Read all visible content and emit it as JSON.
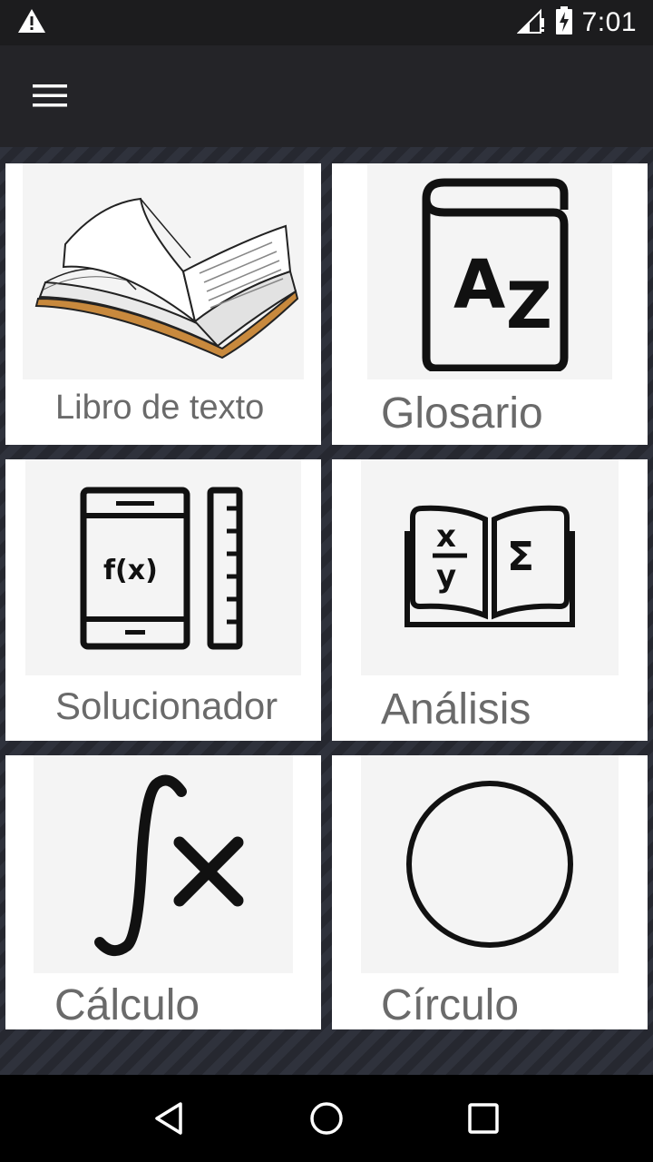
{
  "status_bar": {
    "time": "7:01",
    "icons": [
      "warning-icon",
      "signal-icon",
      "battery-charging-icon"
    ]
  },
  "app_bar": {
    "menu_icon": "hamburger-menu-icon"
  },
  "cards": [
    {
      "label": "Libro de texto",
      "icon": "open-book-icon"
    },
    {
      "label": "Glosario",
      "icon": "glossary-az-book-icon"
    },
    {
      "label": "Solucionador",
      "icon": "calculator-ruler-icon"
    },
    {
      "label": "Análisis",
      "icon": "math-book-icon"
    },
    {
      "label": "Cálculo",
      "icon": "integral-x-icon"
    },
    {
      "label": "Círculo",
      "icon": "circle-icon"
    }
  ],
  "nav_bar": {
    "icons": [
      "back-icon",
      "home-icon",
      "recents-icon"
    ]
  },
  "colors": {
    "status_bar_bg": "#1c1c1e",
    "app_bar_bg": "#242428",
    "card_bg": "#ffffff",
    "label_color": "#6a6a6a"
  }
}
